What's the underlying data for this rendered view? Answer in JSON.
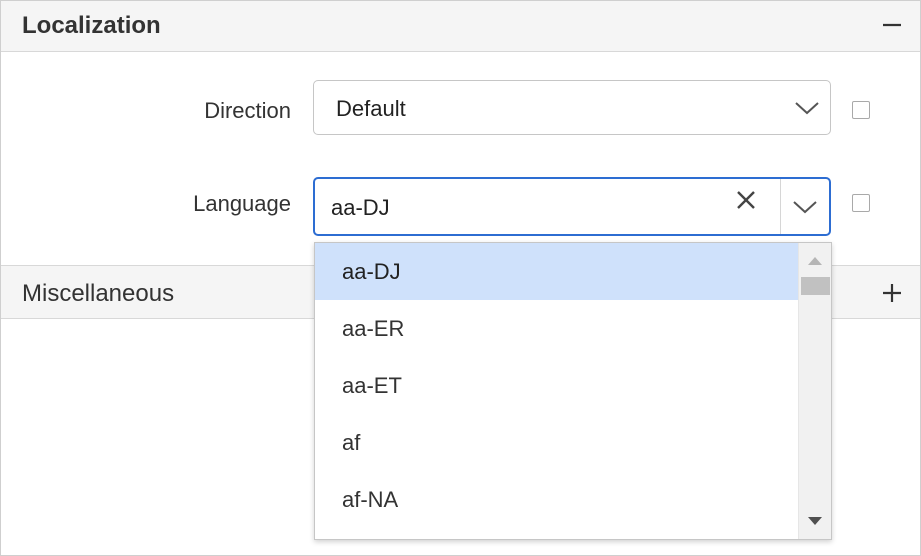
{
  "sections": {
    "localization": {
      "title": "Localization",
      "toggle_icon": "minus-icon"
    },
    "miscellaneous": {
      "title": "Miscellaneous",
      "toggle_icon": "plus-icon"
    }
  },
  "fields": {
    "direction": {
      "label": "Direction",
      "value": "Default",
      "icon": "chevron-down-icon"
    },
    "language": {
      "label": "Language",
      "value": "aa-DJ",
      "clear_icon": "close-icon",
      "icon": "chevron-down-icon"
    }
  },
  "language_dropdown": {
    "selected": "aa-DJ",
    "options": [
      "aa-DJ",
      "aa-ER",
      "aa-ET",
      "af",
      "af-NA"
    ]
  },
  "colors": {
    "focus_border": "#2d6dd2",
    "selected_option_bg": "#cfe1fb",
    "header_bg": "#f5f5f5"
  }
}
